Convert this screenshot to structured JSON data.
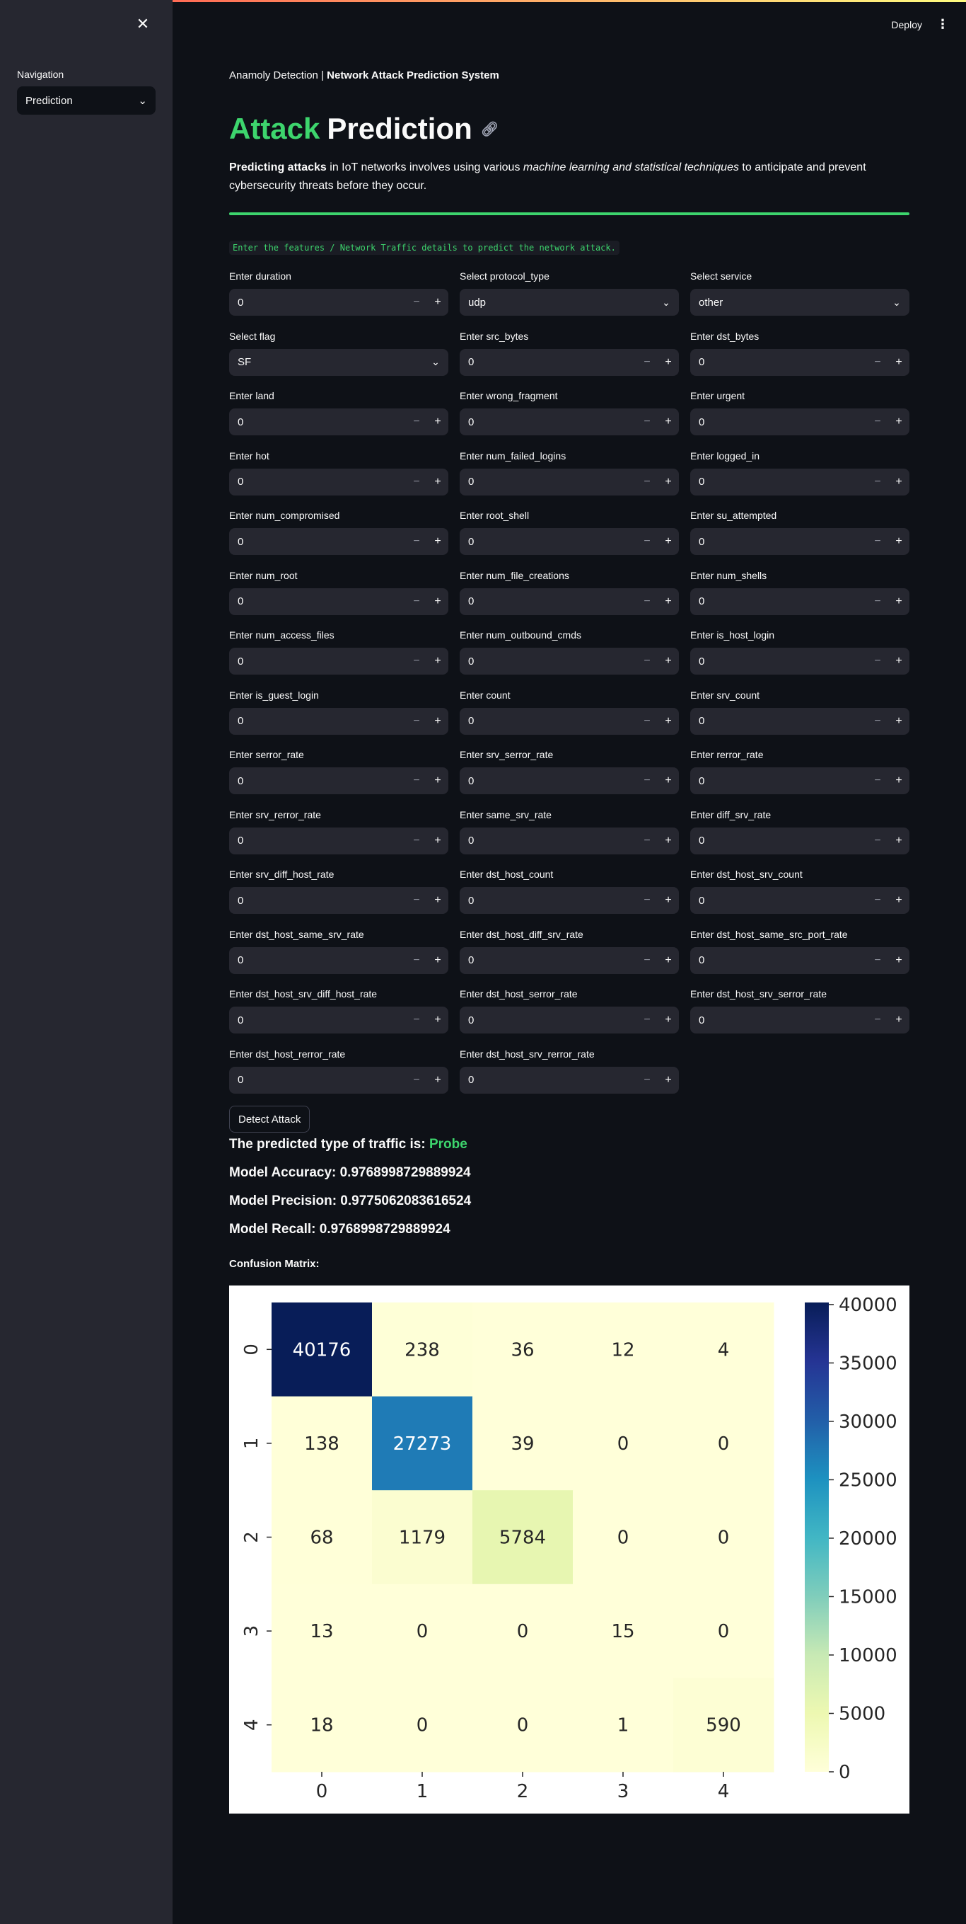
{
  "sidebar": {
    "nav_label": "Navigation",
    "selected_page": "Prediction"
  },
  "header": {
    "deploy_label": "Deploy"
  },
  "breadcrumb": {
    "prefix": "Anamoly Detection | ",
    "bold": "Network Attack Prediction System"
  },
  "title": {
    "green": "Attack",
    "white": "Prediction"
  },
  "description": {
    "bold": "Predicting attacks",
    "text1": " in IoT networks involves using various ",
    "italic": "machine learning and statistical techniques",
    "text2": " to anticipate and prevent cybersecurity threats before they occur."
  },
  "code_note": "Enter the features / Network Traffic details to predict the network attack.",
  "fields": [
    {
      "label": "Enter duration",
      "value": "0",
      "kind": "number"
    },
    {
      "label": "Select protocol_type",
      "value": "udp",
      "kind": "select"
    },
    {
      "label": "Select service",
      "value": "other",
      "kind": "select"
    },
    {
      "label": "Select flag",
      "value": "SF",
      "kind": "select"
    },
    {
      "label": "Enter src_bytes",
      "value": "0",
      "kind": "number"
    },
    {
      "label": "Enter dst_bytes",
      "value": "0",
      "kind": "number"
    },
    {
      "label": "Enter land",
      "value": "0",
      "kind": "number"
    },
    {
      "label": "Enter wrong_fragment",
      "value": "0",
      "kind": "number"
    },
    {
      "label": "Enter urgent",
      "value": "0",
      "kind": "number"
    },
    {
      "label": "Enter hot",
      "value": "0",
      "kind": "number"
    },
    {
      "label": "Enter num_failed_logins",
      "value": "0",
      "kind": "number"
    },
    {
      "label": "Enter logged_in",
      "value": "0",
      "kind": "number"
    },
    {
      "label": "Enter num_compromised",
      "value": "0",
      "kind": "number"
    },
    {
      "label": "Enter root_shell",
      "value": "0",
      "kind": "number"
    },
    {
      "label": "Enter su_attempted",
      "value": "0",
      "kind": "number"
    },
    {
      "label": "Enter num_root",
      "value": "0",
      "kind": "number"
    },
    {
      "label": "Enter num_file_creations",
      "value": "0",
      "kind": "number"
    },
    {
      "label": "Enter num_shells",
      "value": "0",
      "kind": "number"
    },
    {
      "label": "Enter num_access_files",
      "value": "0",
      "kind": "number"
    },
    {
      "label": "Enter num_outbound_cmds",
      "value": "0",
      "kind": "number"
    },
    {
      "label": "Enter is_host_login",
      "value": "0",
      "kind": "number"
    },
    {
      "label": "Enter is_guest_login",
      "value": "0",
      "kind": "number"
    },
    {
      "label": "Enter count",
      "value": "0",
      "kind": "number"
    },
    {
      "label": "Enter srv_count",
      "value": "0",
      "kind": "number"
    },
    {
      "label": "Enter serror_rate",
      "value": "0",
      "kind": "number"
    },
    {
      "label": "Enter srv_serror_rate",
      "value": "0",
      "kind": "number"
    },
    {
      "label": "Enter rerror_rate",
      "value": "0",
      "kind": "number"
    },
    {
      "label": "Enter srv_rerror_rate",
      "value": "0",
      "kind": "number"
    },
    {
      "label": "Enter same_srv_rate",
      "value": "0",
      "kind": "number"
    },
    {
      "label": "Enter diff_srv_rate",
      "value": "0",
      "kind": "number"
    },
    {
      "label": "Enter srv_diff_host_rate",
      "value": "0",
      "kind": "number"
    },
    {
      "label": "Enter dst_host_count",
      "value": "0",
      "kind": "number"
    },
    {
      "label": "Enter dst_host_srv_count",
      "value": "0",
      "kind": "number"
    },
    {
      "label": "Enter dst_host_same_srv_rate",
      "value": "0",
      "kind": "number"
    },
    {
      "label": "Enter dst_host_diff_srv_rate",
      "value": "0",
      "kind": "number"
    },
    {
      "label": "Enter dst_host_same_src_port_rate",
      "value": "0",
      "kind": "number"
    },
    {
      "label": "Enter dst_host_srv_diff_host_rate",
      "value": "0",
      "kind": "number"
    },
    {
      "label": "Enter dst_host_serror_rate",
      "value": "0",
      "kind": "number"
    },
    {
      "label": "Enter dst_host_srv_serror_rate",
      "value": "0",
      "kind": "number"
    },
    {
      "label": "Enter dst_host_rerror_rate",
      "value": "0",
      "kind": "number"
    },
    {
      "label": "Enter dst_host_srv_rerror_rate",
      "value": "0",
      "kind": "number"
    }
  ],
  "detect_button": "Detect Attack",
  "results": {
    "predicted_label": "The predicted type of traffic is: ",
    "predicted_value": "Probe",
    "accuracy": "Model Accuracy: 0.9768998729889924",
    "precision": "Model Precision: 0.9775062083616524",
    "recall": "Model Recall: 0.9768998729889924",
    "cm_title": "Confusion Matrix:"
  },
  "colors": {
    "accent_green": "#3dd56d",
    "sidebar_bg": "#262730",
    "main_bg": "#0e1117"
  },
  "icons": {
    "close": "close-icon",
    "chevron": "chevron-down-icon",
    "link": "link-icon",
    "menu": "kebab-menu-icon"
  },
  "chart_data": {
    "type": "heatmap",
    "x_ticks": [
      "0",
      "1",
      "2",
      "3",
      "4"
    ],
    "y_ticks": [
      "0",
      "1",
      "2",
      "3",
      "4"
    ],
    "values": [
      [
        40176,
        238,
        36,
        12,
        4
      ],
      [
        138,
        27273,
        39,
        0,
        0
      ],
      [
        68,
        1179,
        5784,
        0,
        0
      ],
      [
        13,
        0,
        0,
        15,
        0
      ],
      [
        18,
        0,
        0,
        1,
        590
      ]
    ],
    "colormap": "YlGnBu",
    "colorbar_ticks": [
      0,
      5000,
      10000,
      15000,
      20000,
      25000,
      30000,
      35000,
      40000
    ],
    "colorbar_range": [
      0,
      40176
    ]
  }
}
